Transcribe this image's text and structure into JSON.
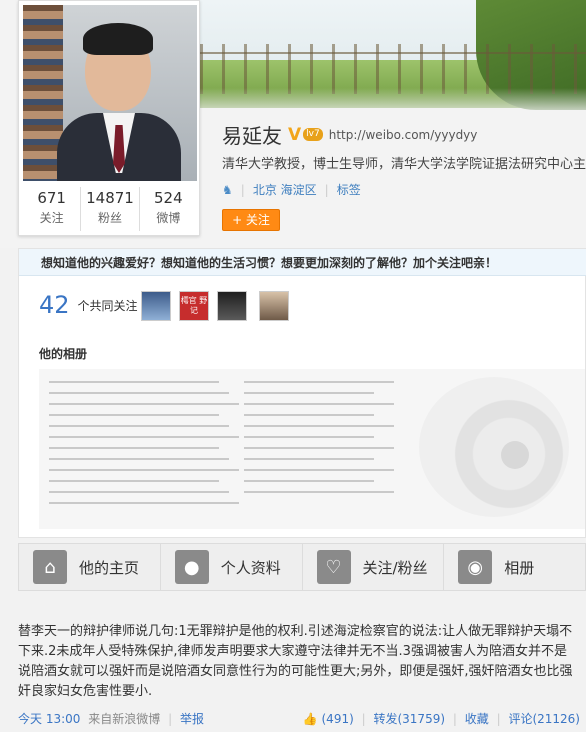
{
  "profile": {
    "name": "易延友",
    "weibo_url": "http://weibo.com/yyydyy",
    "level_badge": "lv7",
    "bio": "清华大学教授，博士生导师，清华大学法学院证据法研究中心主任",
    "location": "北京 海淀区",
    "tags_label": "标签",
    "follow_label": "+ 关注",
    "stats": [
      {
        "value": "671",
        "label": "关注"
      },
      {
        "value": "14871",
        "label": "粉丝"
      },
      {
        "value": "524",
        "label": "微博"
      }
    ]
  },
  "panel": {
    "banner": "想知道他的兴趣爱好？想知道他的生活习惯？想要更加深刻的了解他？加个关注吧亲！",
    "mutual_count": "42",
    "mutual_label": "个共同关注",
    "thumb2_text": "樗官 野记",
    "album_title": "他的相册"
  },
  "nav": [
    {
      "label": "他的主页",
      "icon": "home-icon"
    },
    {
      "label": "个人资料",
      "icon": "person-icon"
    },
    {
      "label": "关注/粉丝",
      "icon": "heart-icon"
    },
    {
      "label": "相册",
      "icon": "camera-icon"
    }
  ],
  "post": {
    "text": "替李天一的辩护律师说几句:1无罪辩护是他的权利.引述海淀检察官的说法:让人做无罪辩护天塌不下来.2未成年人受特殊保护,律师发声明要求大家遵守法律并无不当.3强调被害人为陪酒女并不是说陪酒女就可以强奸而是说陪酒女同意性行为的可能性更大;另外，即便是强奸,强奸陪酒女也比强奸良家妇女危害性要小.",
    "time": "今天 13:00",
    "source": "来自新浪微博",
    "report": "举报",
    "likes": "(491)",
    "repost": "转发(31759)",
    "favorite": "收藏",
    "comment": "评论(21126)"
  }
}
